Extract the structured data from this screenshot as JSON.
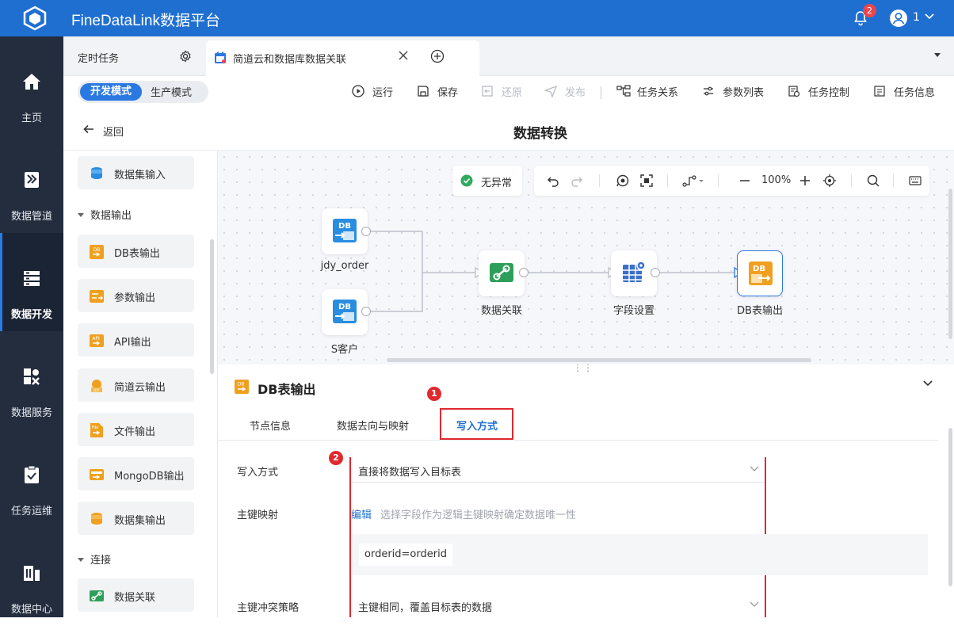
{
  "app": {
    "title": "FineDataLink数据平台",
    "notification_count": "2",
    "user_name": "1"
  },
  "sidenav": [
    {
      "label": "主页",
      "icon": "home-icon",
      "active": false
    },
    {
      "label": "数据管道",
      "icon": "pipeline-icon",
      "active": false
    },
    {
      "label": "数据开发",
      "icon": "dev-icon",
      "active": true
    },
    {
      "label": "数据服务",
      "icon": "service-icon",
      "active": false
    },
    {
      "label": "任务运维",
      "icon": "ops-icon",
      "active": false
    },
    {
      "label": "数据中心",
      "icon": "datacenter-icon",
      "active": false
    }
  ],
  "tabs": {
    "scheduled": "定时任务",
    "current": "简道云和数据库数据关联"
  },
  "toolbar": {
    "mode_dev": "开发模式",
    "mode_prod": "生产模式",
    "run": "运行",
    "save": "保存",
    "restore": "还原",
    "publish": "发布",
    "relation": "任务关系",
    "params": "参数列表",
    "control": "任务控制",
    "info": "任务信息"
  },
  "header": {
    "back": "返回",
    "title": "数据转换"
  },
  "left_panel": {
    "items_top": [
      "数据集输入"
    ],
    "section_output": "数据输出",
    "outputs": [
      "DB表输出",
      "参数输出",
      "API输出",
      "简道云输出",
      "文件输出",
      "MongoDB输出",
      "数据集输出"
    ],
    "section_connect": "连接",
    "connects": [
      "数据关联"
    ]
  },
  "canvas": {
    "status": "无异常",
    "zoom": "100%",
    "nodes": [
      {
        "label": "jdy_order",
        "type": "db-input"
      },
      {
        "label": "S客户",
        "type": "db-input"
      },
      {
        "label": "数据关联",
        "type": "join"
      },
      {
        "label": "字段设置",
        "type": "field-settings"
      },
      {
        "label": "DB表输出",
        "type": "db-output"
      }
    ]
  },
  "detail": {
    "title": "DB表输出",
    "tabs": [
      "节点信息",
      "数据去向与映射",
      "写入方式"
    ],
    "active_tab": "写入方式",
    "markers": [
      "1",
      "2"
    ],
    "write_mode_label": "写入方式",
    "write_mode_value": "直接将数据写入目标表",
    "pk_label": "主键映射",
    "pk_edit": "编辑",
    "pk_hint": "选择字段作为逻辑主键映射确定数据唯一性",
    "pk_value": "orderid=orderid",
    "conflict_label": "主键冲突策略",
    "conflict_value": "主键相同，覆盖目标表的数据"
  },
  "colors": {
    "brand": "#1f6fd1",
    "nav_bg": "#232d3e",
    "highlight": "#e0292f",
    "db_blue": "#2a8de0",
    "output_orange": "#f0a020",
    "join_green": "#2e9f5a"
  }
}
